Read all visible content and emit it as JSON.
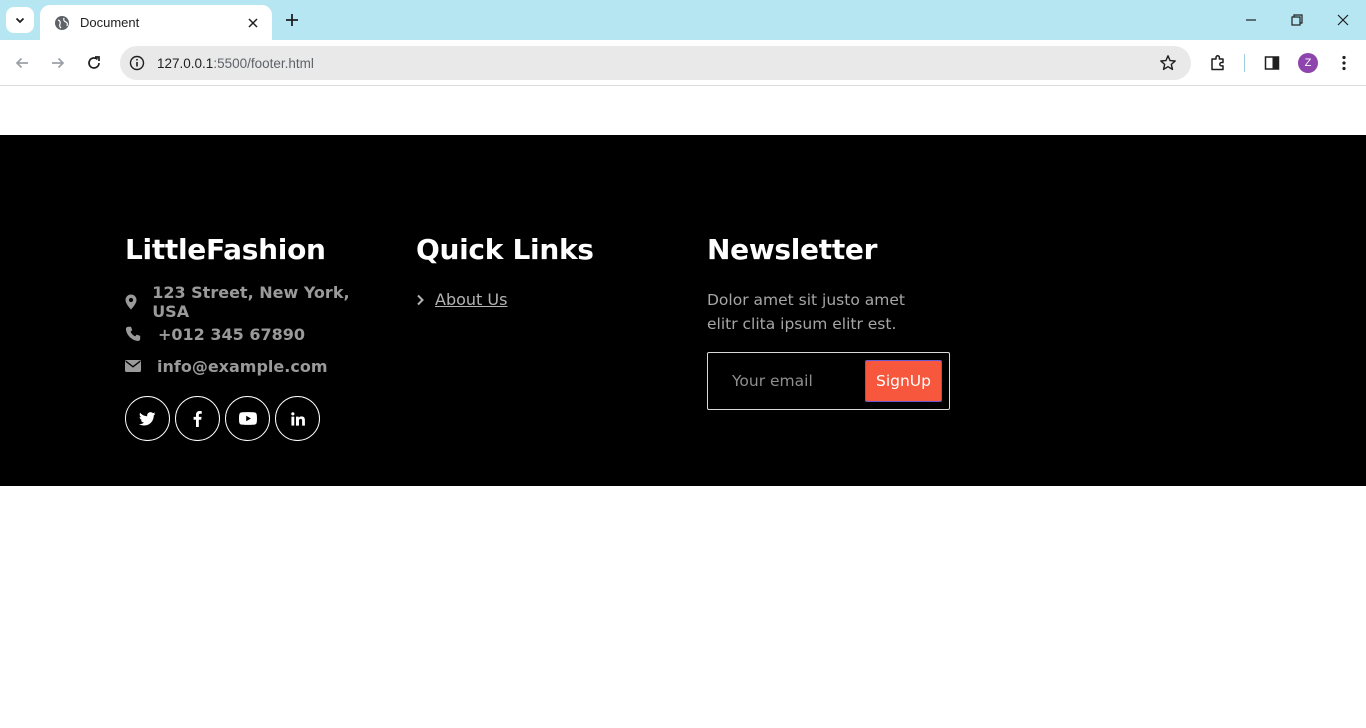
{
  "browser": {
    "tab_title": "Document",
    "url_host": "127.0.0.1",
    "url_path": ":5500/footer.html",
    "profile_initial": "Z"
  },
  "footer": {
    "brand": {
      "title": "LittleFashion",
      "address": "123 Street, New York, USA",
      "phone": "+012 345 67890",
      "email": "info@example.com",
      "socials": [
        "twitter-icon",
        "facebook-icon",
        "youtube-icon",
        "linkedin-icon"
      ]
    },
    "quick_links": {
      "title": "Quick Links",
      "items": [
        {
          "label": "About Us"
        }
      ]
    },
    "newsletter": {
      "title": "Newsletter",
      "text": "Dolor amet sit justo amet elitr clita ipsum elitr est.",
      "email_placeholder": "Your email",
      "button_label": "SignUp",
      "button_color": "#f7573c"
    }
  }
}
